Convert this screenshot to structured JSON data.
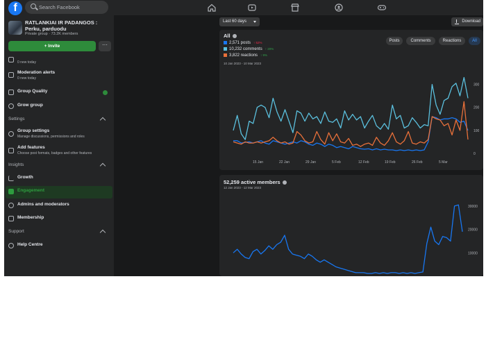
{
  "header": {
    "logo_letter": "f",
    "search_placeholder": "Search Facebook",
    "nav_icons": [
      "home-icon",
      "watch-icon",
      "marketplace-icon",
      "groups-icon",
      "gaming-icon"
    ]
  },
  "group": {
    "name": "RATLANKIAI IR PADANGOS : Perku, parduodu",
    "meta": "Private group · 73.2K members",
    "invite_label": "+ Invite",
    "more_label": "···"
  },
  "sidebar": {
    "items_top": [
      {
        "label": "",
        "sub": "0 new today"
      },
      {
        "label": "Moderation alerts",
        "sub": "0 new today"
      },
      {
        "label": "Group Quality",
        "sub": ""
      },
      {
        "label": "Grow group",
        "sub": ""
      }
    ],
    "settings_header": "Settings",
    "settings_items": [
      {
        "label": "Group settings",
        "sub": "Manage discussions, permissions and roles"
      },
      {
        "label": "Add features",
        "sub": "Choose post formats, badges and other features"
      }
    ],
    "insights_header": "Insights",
    "insights_items": [
      {
        "label": "Growth"
      },
      {
        "label": "Engagement"
      },
      {
        "label": "Admins and moderators"
      },
      {
        "label": "Membership"
      }
    ],
    "support_header": "Support",
    "support_items": [
      {
        "label": "Help Centre"
      }
    ]
  },
  "toolbar": {
    "range_select": "Last 60 days",
    "download_label": "Download"
  },
  "colors": {
    "posts": "#1877f2",
    "comments": "#5bc0de",
    "reactions": "#e8703a",
    "members": "#1877f2",
    "accent_green": "#2e8b3b"
  },
  "engagement": {
    "title": "All",
    "legend": [
      {
        "label": "2,571 posts",
        "pct": "↑ 52%",
        "pct_color": "#f02849"
      },
      {
        "label": "10,232 comments",
        "pct": "↑ 20%",
        "pct_color": "#31a24c"
      },
      {
        "label": "3,822 reactions",
        "pct": "↑ 9%",
        "pct_color": "#31a24c"
      }
    ],
    "range": "10 Jan 2023 - 10 Mar 2023",
    "filters": [
      "Posts",
      "Comments",
      "Reactions",
      "All"
    ]
  },
  "members": {
    "title": "52,259 active members",
    "range": "12 Jan 2023 - 12 Mar 2023"
  },
  "chart_data": [
    {
      "type": "line",
      "x_ticks": [
        "15 Jan",
        "22 Jan",
        "29 Jan",
        "5 Feb",
        "12 Feb",
        "19 Feb",
        "26 Feb",
        "5 Mar"
      ],
      "y_ticks": [
        0,
        100,
        200,
        300
      ],
      "ylim": [
        0,
        350
      ],
      "grid": false,
      "series": [
        {
          "name": "posts",
          "values": [
            55,
            55,
            45,
            48,
            50,
            45,
            50,
            55,
            45,
            40,
            55,
            50,
            45,
            40,
            45,
            50,
            45,
            55,
            50,
            40,
            35,
            45,
            40,
            30,
            40,
            35,
            25,
            30,
            25,
            20,
            30,
            25,
            20,
            18,
            20,
            15,
            20,
            15,
            18,
            15,
            15,
            12,
            15,
            12,
            15,
            12,
            15,
            12,
            15,
            50,
            160,
            155,
            145,
            150,
            150,
            155,
            150,
            135,
            140,
            100
          ]
        },
        {
          "name": "comments",
          "values": [
            100,
            165,
            85,
            60,
            140,
            130,
            200,
            210,
            200,
            155,
            240,
            180,
            140,
            190,
            140,
            90,
            185,
            175,
            140,
            175,
            150,
            160,
            130,
            180,
            140,
            135,
            150,
            110,
            185,
            145,
            170,
            145,
            160,
            110,
            140,
            165,
            120,
            105,
            130,
            105,
            210,
            150,
            165,
            110,
            120,
            155,
            135,
            110,
            125,
            120,
            300,
            210,
            170,
            230,
            240,
            290,
            305,
            250,
            330,
            240
          ]
        },
        {
          "name": "reactions",
          "values": [
            50,
            45,
            40,
            50,
            45,
            45,
            50,
            45,
            50,
            55,
            70,
            55,
            45,
            50,
            40,
            45,
            95,
            80,
            55,
            45,
            50,
            95,
            60,
            40,
            90,
            55,
            85,
            50,
            45,
            65,
            35,
            40,
            30,
            40,
            45,
            35,
            70,
            45,
            35,
            55,
            90,
            50,
            40,
            55,
            95,
            45,
            40,
            50,
            45,
            60,
            160,
            150,
            145,
            120,
            130,
            80,
            145,
            100,
            225,
            60
          ]
        }
      ]
    },
    {
      "type": "line",
      "y_ticks": [
        10000,
        20000,
        30000
      ],
      "ylim": [
        0,
        35000
      ],
      "grid": false,
      "series": [
        {
          "name": "active members",
          "values": [
            10000,
            11500,
            9500,
            8000,
            7500,
            10500,
            11500,
            9500,
            11000,
            13000,
            11500,
            13500,
            14500,
            17500,
            11500,
            9500,
            9000,
            8500,
            7500,
            9500,
            8500,
            7000,
            6000,
            7000,
            6000,
            5000,
            4000,
            3500,
            3000,
            2500,
            2000,
            1500,
            1500,
            1500,
            1200,
            1200,
            1500,
            1200,
            1500,
            1200,
            1500,
            1500,
            1200,
            1500,
            1200,
            1500,
            1200,
            1500,
            1800,
            14000,
            21000,
            15000,
            13500,
            17000,
            16500,
            15000,
            30000,
            30500,
            19000
          ]
        }
      ]
    }
  ]
}
